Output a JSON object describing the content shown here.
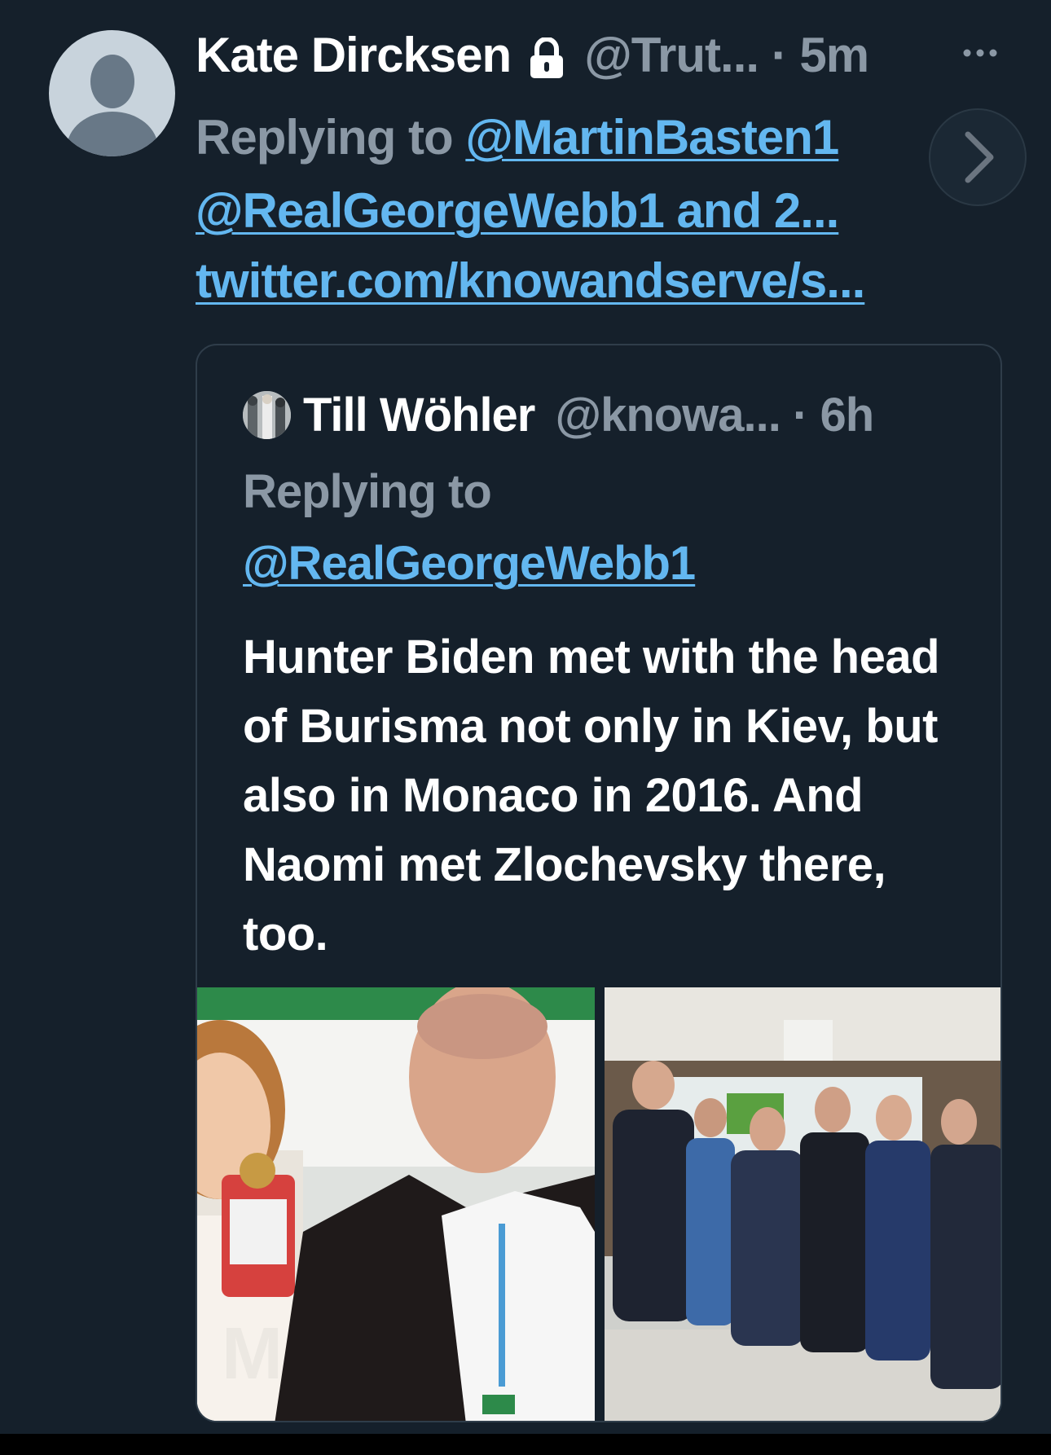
{
  "tweet": {
    "display_name": "Kate Dircksen",
    "handle_time": "@Trut... · 5m",
    "replying_prefix": "Replying to",
    "reply_user_1": "@MartinBasten1",
    "reply_user_2": "@RealGeorgeWebb1 and 2...",
    "link_url": "twitter.com/knowandserve/s...",
    "icons": [
      "default-avatar",
      "lock-icon",
      "more-icon",
      "chevron-right-icon"
    ]
  },
  "quoted_tweet": {
    "display_name": "Till Wöhler",
    "handle_time": "@knowa... · 6h",
    "replying_prefix": "Replying to",
    "reply_user": "@RealGeorgeWebb1",
    "text": "Hunter Biden met with the head of Burisma not only in Kiev, but also in Monaco in 2016. And Naomi met Zlochevsky there, too.",
    "media": [
      {
        "description": "woman and man at event"
      },
      {
        "description": "group of men in suits at conference"
      }
    ]
  },
  "colors": {
    "background": "#15202b",
    "link": "#1d9bf0",
    "secondary_text": "#8b98a5",
    "border": "#2f3d4a"
  }
}
